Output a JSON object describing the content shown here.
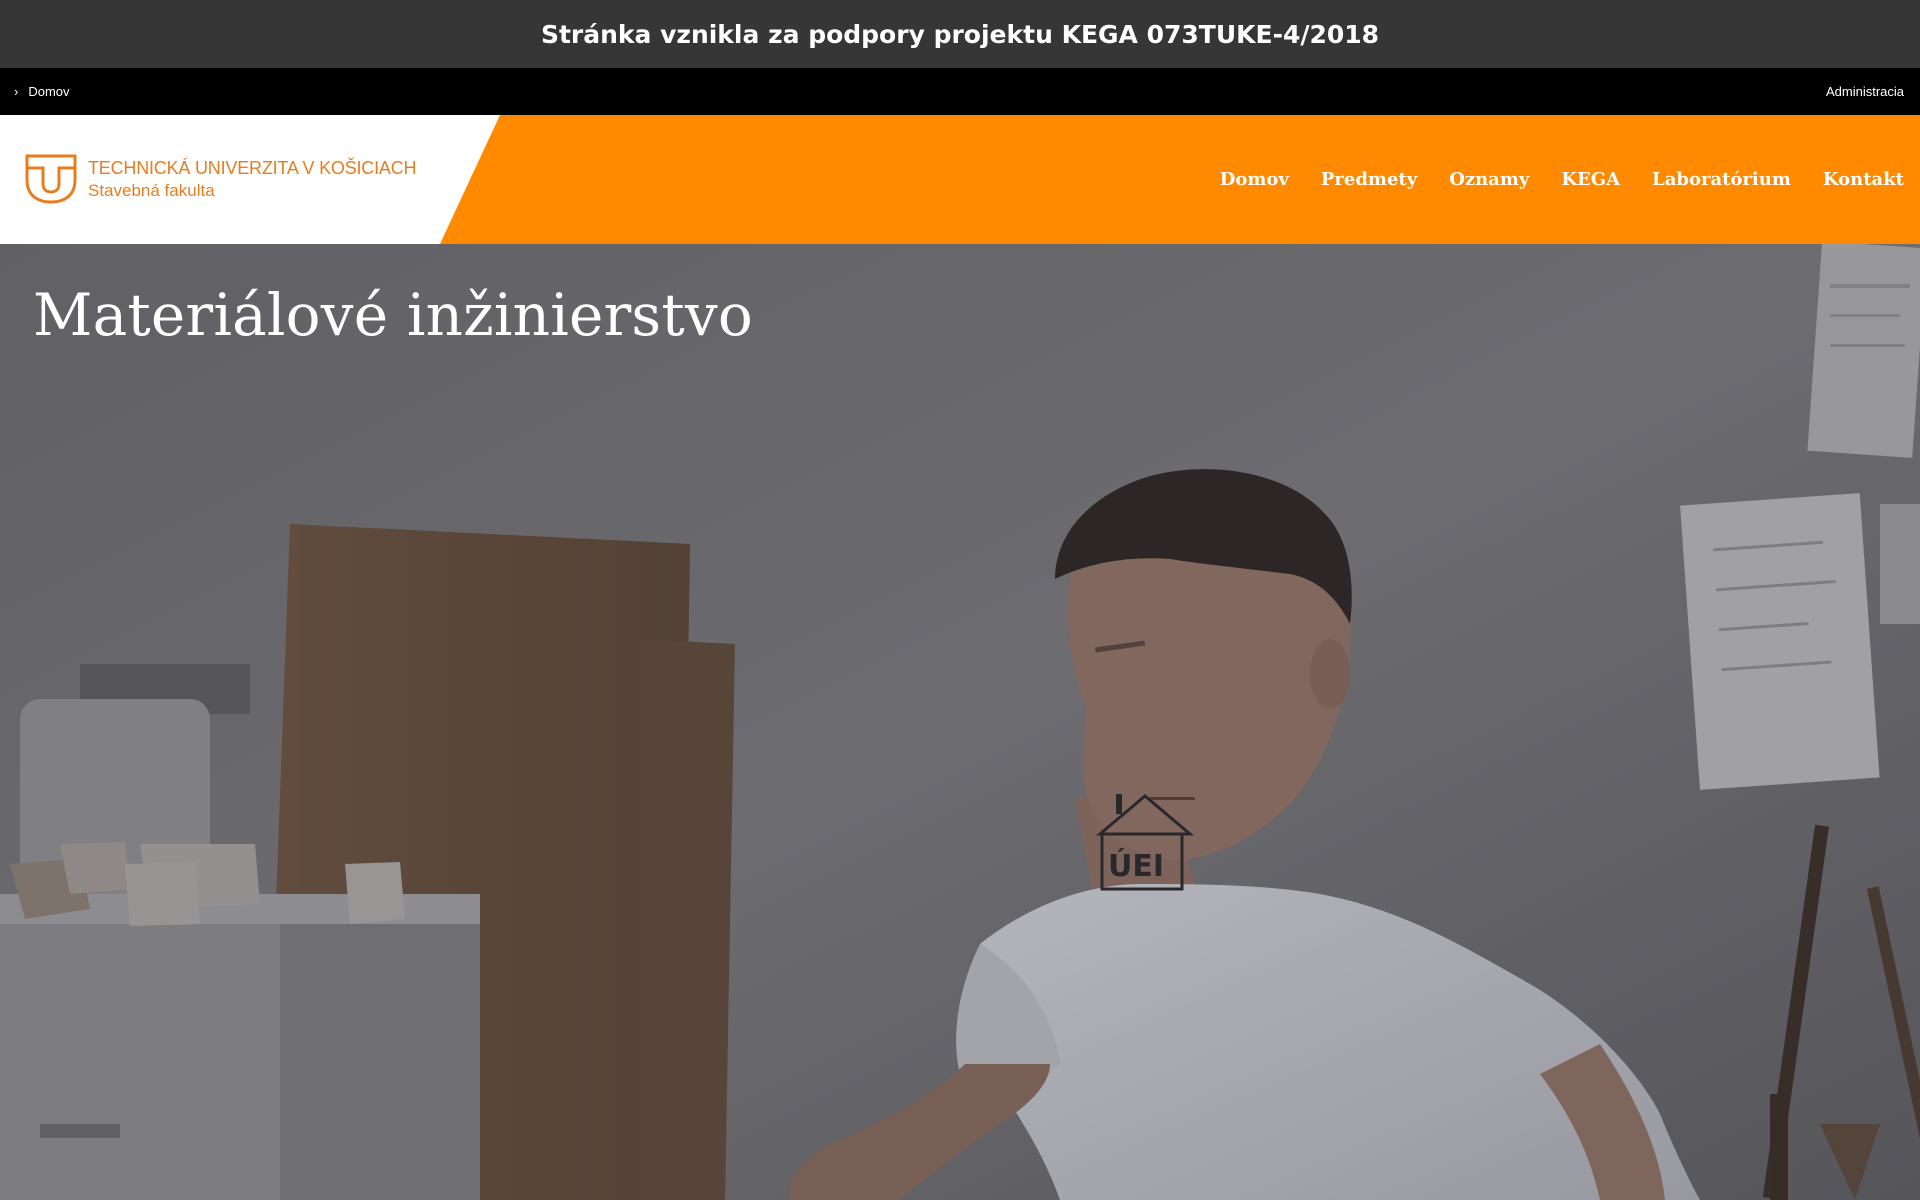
{
  "banner": {
    "text": "Stránka vznikla za podpory projektu KEGA 073TUKE-4/2018"
  },
  "topbar": {
    "breadcrumb": "Domov",
    "admin_link": "Administracia"
  },
  "logo": {
    "line1": "TECHNICKÁ UNIVERZITA V KOŠICIACH",
    "line2": "Stavebná fakulta",
    "icon": "tuke-logo"
  },
  "nav": {
    "items": [
      {
        "label": "Domov"
      },
      {
        "label": "Predmety"
      },
      {
        "label": "Oznamy"
      },
      {
        "label": "KEGA"
      },
      {
        "label": "Laboratórium"
      },
      {
        "label": "Kontakt"
      }
    ]
  },
  "hero": {
    "title": "Materiálové inžinierstvo",
    "shirt_print": "ÚEI"
  },
  "colors": {
    "accent": "#ff8a00",
    "logo": "#e87d1e",
    "banner_bg": "#363636",
    "topbar_bg": "#000000"
  }
}
